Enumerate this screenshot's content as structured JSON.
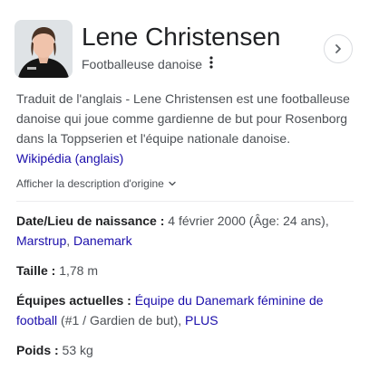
{
  "header": {
    "name": "Lene Christensen",
    "subtitle": "Footballeuse danoise",
    "more_icon": "three-dots-vertical-icon",
    "share_icon": "chevron-right-icon"
  },
  "description": {
    "text": "Traduit de l'anglais - Lene Christensen est une footballeuse danoise qui joue comme gardienne de but pour Rosenborg dans la Toppserien et l'équipe nationale danoise.",
    "source_link": "Wikipédia (anglais)"
  },
  "show_original": "Afficher la description d'origine",
  "facts": {
    "birth": {
      "label": "Date/Lieu de naissance :",
      "value": " 4 février 2000 (Âge: 24 ans),",
      "link_place": "Marstrup",
      "sep": ", ",
      "link_country": "Danemark"
    },
    "height": {
      "label": "Taille :",
      "value": " 1,78 m"
    },
    "teams": {
      "label": "Équipes actuelles :",
      "link_team": "Équipe du Danemark féminine de football",
      "detail": " (#1 / Gardien de but), ",
      "link_more": "PLUS"
    },
    "weight": {
      "label": "Poids :",
      "value": " 53 kg"
    }
  },
  "colors": {
    "link": "#1a0dab",
    "text": "#4d5156",
    "heading": "#202124"
  }
}
